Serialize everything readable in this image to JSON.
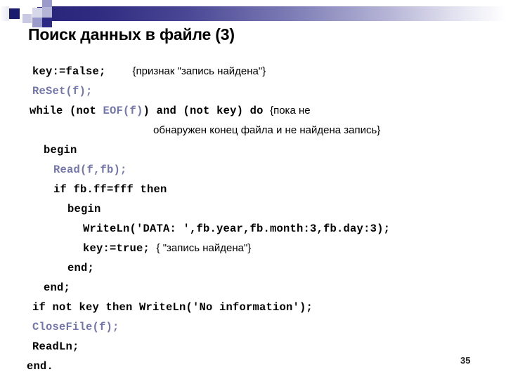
{
  "slide": {
    "title": "Поиск данных в файле (3)",
    "page_number": "35"
  },
  "theme": {
    "header_gradient_start": "#272479",
    "header_gradient_end": "#ffffff",
    "code_keyword_color": "#000000",
    "code_identifier_color": "#7376ad",
    "comment_color": "#000000",
    "background": "#ffffff"
  },
  "decoration": {
    "squares": [
      {
        "name": "square-dark-navy",
        "color": "#1a1a6e"
      },
      {
        "name": "square-pale-lilac",
        "color": "#c9c9e4"
      },
      {
        "name": "square-light-grey",
        "color": "#d7d7ea"
      },
      {
        "name": "square-mid-violet",
        "color": "#9b9bcb"
      },
      {
        "name": "square-soft-violet",
        "color": "#b5b5d8"
      },
      {
        "name": "square-indigo",
        "color": "#2c2a84"
      }
    ]
  },
  "code": {
    "lines": [
      {
        "indent": 8,
        "segments": [
          {
            "type": "code",
            "text": "key:=false;"
          },
          {
            "type": "code",
            "text": "    "
          },
          {
            "type": "comment",
            "text": "{признак \"запись найдена\"}"
          }
        ]
      },
      {
        "indent": 8,
        "segments": [
          {
            "type": "ident",
            "text": "ReSet(f);"
          }
        ]
      },
      {
        "indent": 4,
        "segments": [
          {
            "type": "code",
            "text": "while (not "
          },
          {
            "type": "ident",
            "text": "EOF(f)"
          },
          {
            "type": "code",
            "text": ") and (not key) do "
          },
          {
            "type": "comment",
            "text": "{пока не"
          }
        ]
      },
      {
        "indent": 180,
        "segments": [
          {
            "type": "comment",
            "text": "обнаружен конец файла и не найдена запись}"
          }
        ]
      },
      {
        "indent": 24,
        "segments": [
          {
            "type": "code",
            "text": "begin"
          }
        ]
      },
      {
        "indent": 38,
        "segments": [
          {
            "type": "ident",
            "text": "Read(f,fb);"
          }
        ]
      },
      {
        "indent": 38,
        "segments": [
          {
            "type": "code",
            "text": "if fb.ff=fff then"
          }
        ]
      },
      {
        "indent": 58,
        "segments": [
          {
            "type": "code",
            "text": "begin"
          }
        ]
      },
      {
        "indent": 80,
        "segments": [
          {
            "type": "code",
            "text": "WriteLn('DATA: ',fb.year,fb.month:3,fb.day:3);"
          }
        ]
      },
      {
        "indent": 80,
        "segments": [
          {
            "type": "code",
            "text": "key:=true; "
          },
          {
            "type": "comment",
            "text": "{ \"запись найдена\"}"
          }
        ]
      },
      {
        "indent": 58,
        "segments": [
          {
            "type": "code",
            "text": "end;"
          }
        ]
      },
      {
        "indent": 24,
        "segments": [
          {
            "type": "code",
            "text": "end;"
          }
        ]
      },
      {
        "indent": 8,
        "segments": [
          {
            "type": "code",
            "text": "if not key then WriteLn('No information');"
          }
        ]
      },
      {
        "indent": 8,
        "segments": [
          {
            "type": "ident",
            "text": "CloseFile(f);"
          }
        ]
      },
      {
        "indent": 8,
        "segments": [
          {
            "type": "code",
            "text": "ReadLn;"
          }
        ]
      },
      {
        "indent": -8,
        "segments": [
          {
            "type": "code",
            "text": "end."
          }
        ]
      }
    ]
  }
}
